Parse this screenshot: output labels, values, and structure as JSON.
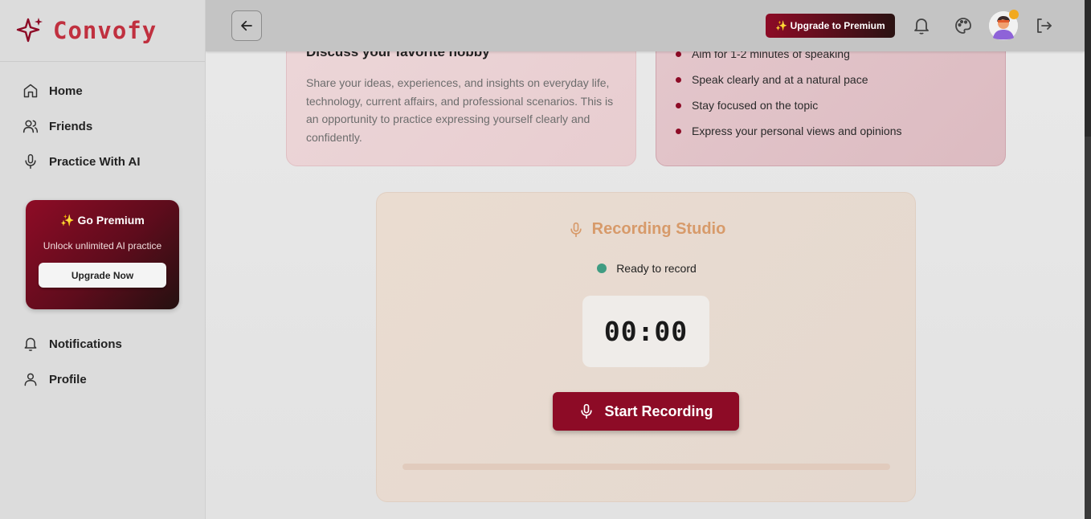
{
  "brand": {
    "name": "Convofy"
  },
  "sidebar": {
    "items": [
      {
        "label": "Home",
        "icon": "home-icon"
      },
      {
        "label": "Friends",
        "icon": "users-icon"
      },
      {
        "label": "Practice With AI",
        "icon": "microphone-icon"
      }
    ],
    "premium": {
      "title": "✨ Go Premium",
      "subtitle": "Unlock unlimited AI practice",
      "button": "Upgrade Now"
    },
    "bottom_items": [
      {
        "label": "Notifications",
        "icon": "bell-icon"
      },
      {
        "label": "Profile",
        "icon": "user-icon"
      }
    ]
  },
  "topbar": {
    "upgrade_label": "✨ Upgrade to Premium",
    "icons": [
      "arrow-left-icon",
      "bell-icon",
      "palette-icon",
      "avatar",
      "logout-icon"
    ]
  },
  "topic_card": {
    "title": "Discuss your favorite hobby",
    "description": "Share your ideas, experiences, and insights on everyday life, technology, current affairs, and professional scenarios. This is an opportunity to practice expressing yourself clearly and confidently."
  },
  "tips_card": {
    "items": [
      "Aim for 1-2 minutes of speaking",
      "Speak clearly and at a natural pace",
      "Stay focused on the topic",
      "Express your personal views and opinions"
    ]
  },
  "studio": {
    "title": "Recording Studio",
    "status": "Ready to record",
    "timer": "00:00",
    "button": "Start Recording",
    "progress": 0
  },
  "colors": {
    "brand": "#c0303f",
    "primary": "#8d0b26",
    "accent": "#d79a6a",
    "status_ready": "#3f9c82"
  }
}
